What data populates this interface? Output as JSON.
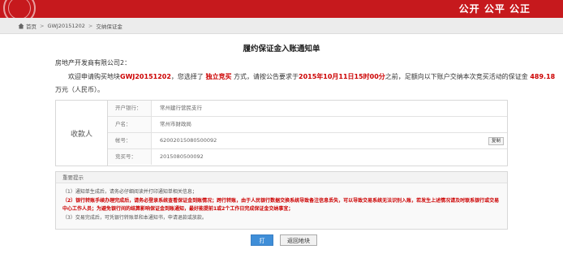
{
  "header": {
    "slogan": "公开 公平 公正",
    "brand_color": "#c6191d"
  },
  "breadcrumb": {
    "home": "首页",
    "item1": "GWJ20151202",
    "item2": "交纳保证金"
  },
  "doc": {
    "title": "履约保证金入账通知单",
    "salutation": "房地产开发商有限公司2：",
    "para_p1": "欢迎申请购买地块",
    "parcel_id": "GWJ20151202",
    "para_p2": "，您选择了",
    "method": "独立竞买",
    "para_p3": "方式，请按公告要求于",
    "deadline": "2015年10月11日15时00分",
    "para_p4": "之前，足额向以下账户交纳本次竞买活动的保证金",
    "amount": "489.18",
    "para_p5": "万元（人民币）。"
  },
  "payee": {
    "label": "收款人",
    "rows": [
      {
        "key": "开户银行：",
        "value": "常州建行营民支行"
      },
      {
        "key": "户名：",
        "value": "常州市财政局"
      },
      {
        "key": "帐号：",
        "value": "62002015080500092"
      },
      {
        "key": "竞买号：",
        "value": "2015080500092"
      }
    ],
    "copy_label": "复制"
  },
  "notice": {
    "title": "重要提示",
    "line1": "（1）通知单生成后，请务必仔细阅读并打印通知单相关信息；",
    "line2": "（2）银行转账手续办理完成后，请务必登录系统查看保证金到账情况；跨行转账，由于人民银行数据交换系统导致备注信息丢失，可以导致交易系统无法识别入账，若发生上述情况请及时联系银行或交易中心工作人员；为避免银行间的结算影响保证金到账通知，最好能提前1或2个工作日完成保证金交纳事宜；",
    "line3": "（3）交易完成后，可凭银行转账单和本通知书，申请退款或放款。"
  },
  "actions": {
    "print": "打印",
    "back": "返回地块"
  }
}
